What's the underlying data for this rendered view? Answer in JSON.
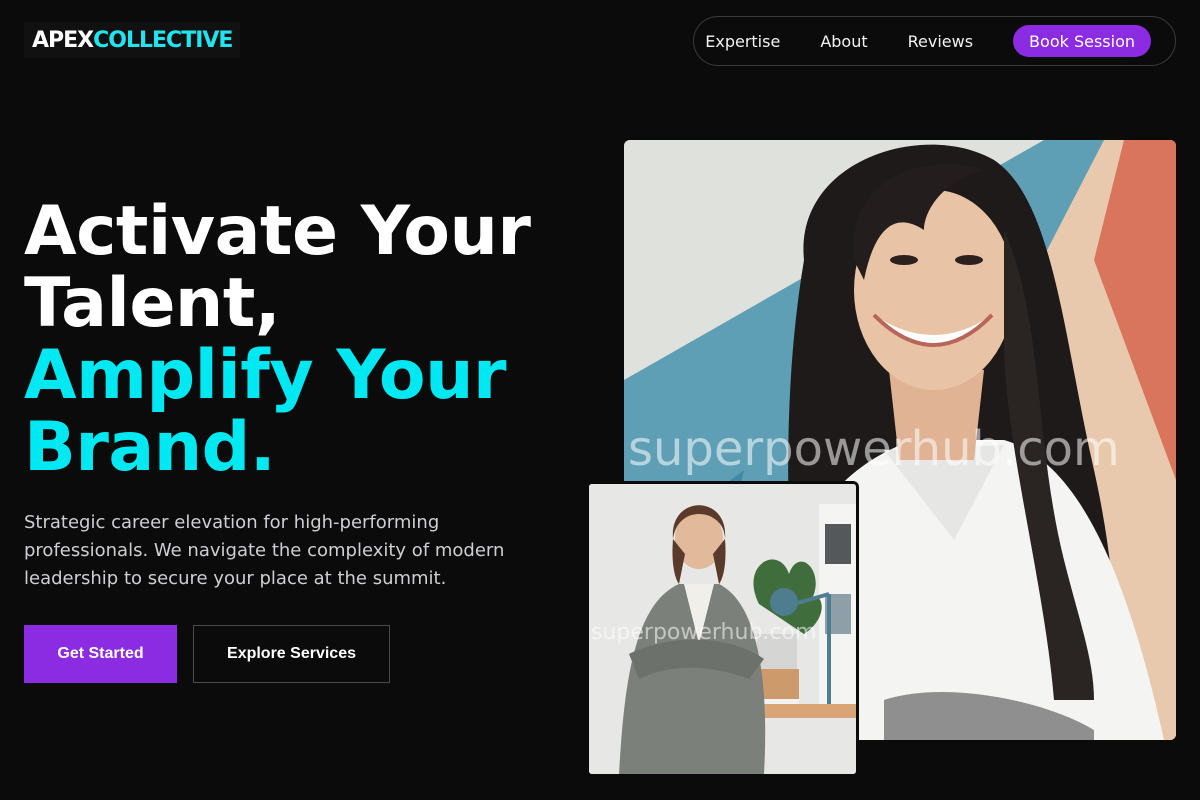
{
  "brand": {
    "logo_part1": "APEX",
    "logo_part2": "COLLECTIVE",
    "accent_color": "#22e4ef",
    "primary_color": "#8b2be2"
  },
  "nav": {
    "items": [
      {
        "label": "Expertise"
      },
      {
        "label": "About"
      },
      {
        "label": "Reviews"
      }
    ],
    "cta_label": "Book Session"
  },
  "hero": {
    "headline_white_1": "Activate Your",
    "headline_white_2": "Talent,",
    "headline_cyan_1": "Amplify Your",
    "headline_cyan_2": "Brand.",
    "subtext": "Strategic career elevation for high-performing professionals. We navigate the complexity of modern leadership to secure your place at the summit.",
    "primary_button": "Get Started",
    "secondary_button": "Explore Services"
  },
  "images": {
    "main_watermark": "superpowerhub.com",
    "inset_watermark": "superpowerhub.com"
  }
}
